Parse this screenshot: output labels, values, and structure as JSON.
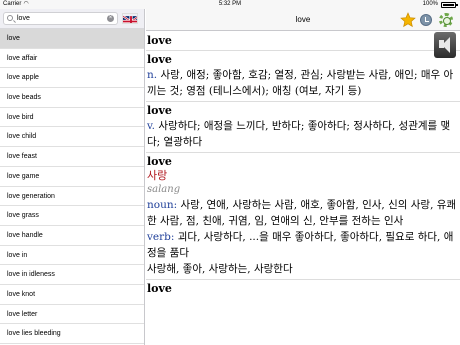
{
  "status_bar": {
    "carrier": "Carrier",
    "time": "5:32 PM",
    "battery": "100%"
  },
  "search": {
    "value": "love",
    "placeholder": ""
  },
  "language_flag": "uk-flag",
  "word_list": [
    {
      "label": "love",
      "selected": true
    },
    {
      "label": "love affair"
    },
    {
      "label": "love apple"
    },
    {
      "label": "love beads"
    },
    {
      "label": "love bird"
    },
    {
      "label": "love child"
    },
    {
      "label": "love feast"
    },
    {
      "label": "love game"
    },
    {
      "label": "love generation"
    },
    {
      "label": "love grass"
    },
    {
      "label": "love handle"
    },
    {
      "label": "love in"
    },
    {
      "label": "love in idleness"
    },
    {
      "label": "love knot"
    },
    {
      "label": "love letter"
    },
    {
      "label": "love lies bleeding"
    }
  ],
  "header": {
    "title": "love",
    "icons": [
      "star-icon",
      "history-icon",
      "settings-icon"
    ]
  },
  "content": {
    "top_word": "love",
    "entry1": {
      "word": "love",
      "pos": "n.",
      "text": " 사랑, 애정; 좋아함, 호감; 열정, 관심; 사랑받는 사람, 애인; 매우 아끼는 것; 영점 (테니스에서); 애칭 (여보, 자기 등)"
    },
    "entry2": {
      "word": "love",
      "pos": "v.",
      "text": " 사랑하다; 애정을 느끼다, 반하다; 좋아하다; 정사하다, 성관계를 맺다; 열광하다"
    },
    "entry3": {
      "word": "love",
      "korean": "사랑",
      "romanization": "salang",
      "noun_pos": "noun:",
      "noun_text": " 사랑, 연애, 사랑하는 사람, 애호, 좋아함, 인사, 신의 사랑, 유쾌한 사람, 점, 친애, 귀염, 임, 연애의 신, 안부를 전하는 인사",
      "verb_pos": "verb:",
      "verb_text": " 괴다, 사랑하다, ...을 매우 좋아하다, 좋아하다, 필요로 하다, 애정을 품다",
      "extra": "사랑해, 좋아, 사랑하는, 사랑한다"
    },
    "entry4": {
      "word": "love"
    }
  }
}
